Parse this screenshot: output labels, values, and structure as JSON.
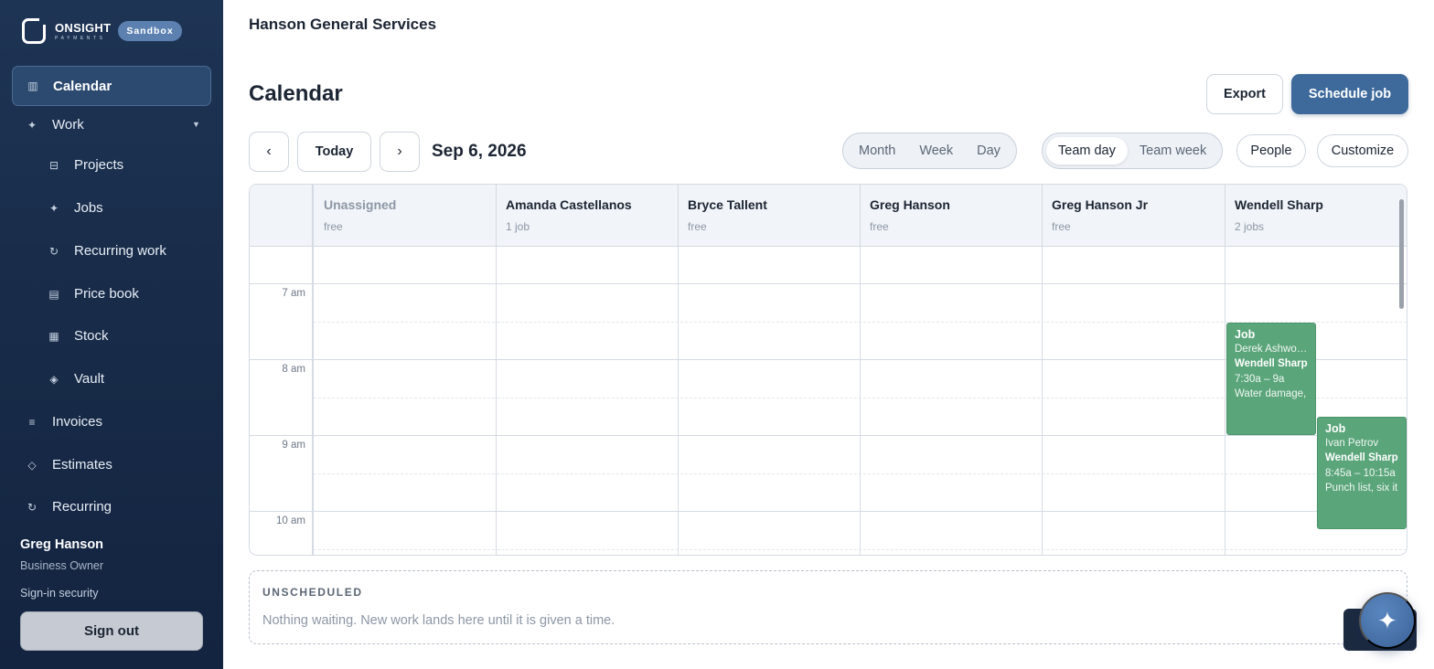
{
  "brand": {
    "name": "ONSIGHT",
    "sub": "PAYMENTS",
    "badge": "Sandbox"
  },
  "sidebar": {
    "items": [
      {
        "label": "Calendar",
        "icon": "calendar-icon",
        "glyph": "▥",
        "active": true
      },
      {
        "label": "Work",
        "icon": "sparkle-icon",
        "glyph": "✦",
        "expanded": true
      },
      {
        "label": "Projects",
        "icon": "projects-icon",
        "glyph": "⊟"
      },
      {
        "label": "Jobs",
        "icon": "sparkle-icon",
        "glyph": "✦"
      },
      {
        "label": "Recurring work",
        "icon": "refresh-icon",
        "glyph": "↻"
      },
      {
        "label": "Price book",
        "icon": "book-icon",
        "glyph": "▤"
      },
      {
        "label": "Stock",
        "icon": "grid-icon",
        "glyph": "▦"
      },
      {
        "label": "Vault",
        "icon": "diamond-icon",
        "glyph": "◈"
      },
      {
        "label": "Invoices",
        "icon": "list-icon",
        "glyph": "≡"
      },
      {
        "label": "Estimates",
        "icon": "diamond-outline-icon",
        "glyph": "◇"
      },
      {
        "label": "Recurring",
        "icon": "refresh-icon",
        "glyph": "↻"
      }
    ],
    "user": {
      "name": "Greg Hanson",
      "role": "Business Owner",
      "security": "Sign-in security",
      "signout": "Sign out"
    }
  },
  "header": {
    "company": "Hanson General Services"
  },
  "page": {
    "title": "Calendar",
    "export": "Export",
    "schedule": "Schedule job"
  },
  "toolbar": {
    "prev": "‹",
    "today": "Today",
    "next": "›",
    "date": "Sep 6, 2026",
    "views": [
      "Month",
      "Week",
      "Day"
    ],
    "team_views": [
      "Team day",
      "Team week"
    ],
    "team_selected": "Team day",
    "people": "People",
    "customize": "Customize"
  },
  "calendar": {
    "columns": [
      {
        "name": "Unassigned",
        "sub": "free"
      },
      {
        "name": "Amanda Castellanos",
        "sub": "1 job"
      },
      {
        "name": "Bryce Tallent",
        "sub": "free"
      },
      {
        "name": "Greg Hanson",
        "sub": "free"
      },
      {
        "name": "Greg Hanson Jr",
        "sub": "free"
      },
      {
        "name": "Wendell Sharp",
        "sub": "2 jobs"
      }
    ],
    "times": [
      "7 am",
      "8 am",
      "9 am",
      "10 am"
    ],
    "events": [
      {
        "title": "Job",
        "customer": "Derek Ashwo…",
        "tech": "Wendell Sharp",
        "time": "7:30a – 9a",
        "note": "Water damage,"
      },
      {
        "title": "Job",
        "customer": "Ivan Petrov",
        "tech": "Wendell Sharp",
        "time": "8:45a – 10:15a",
        "note": "Punch list, six it"
      }
    ],
    "event_color": "#5aa57a"
  },
  "unscheduled": {
    "title": "UNSCHEDULED",
    "text": "Nothing waiting. New work lands here until it is given a time."
  },
  "fab": {
    "icon": "sparkle-icon",
    "glyph": "✦"
  },
  "colors": {
    "sidebar": "#1e3454",
    "accent": "#3e6a9b",
    "event": "#5aa57a"
  }
}
